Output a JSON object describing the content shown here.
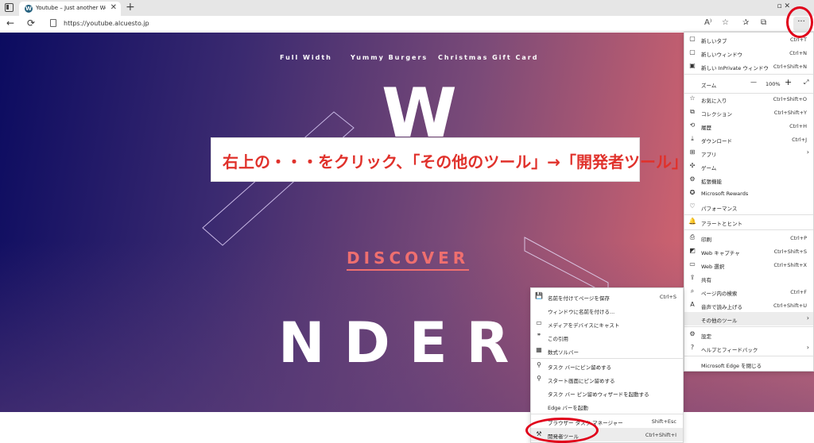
{
  "tab": {
    "title": "Youtube – Just another WordPre",
    "close": "✕",
    "new": "+"
  },
  "window": {
    "controls": "▫  ✕"
  },
  "address": {
    "back": "←",
    "reload": "⟳",
    "url": "https://youtube.alcuesto.jp",
    "more": "···"
  },
  "toolbar_icons": [
    "read-aloud-icon",
    "favorite-icon",
    "collections-star-icon",
    "collections-icon"
  ],
  "page": {
    "nav": [
      "Full Width",
      "Yummy Burgers",
      "Christmas Gift Card"
    ],
    "w": "W",
    "discover": "DISCOVER",
    "nder": "NDER"
  },
  "annotation": {
    "text": "右上の・・・をクリック、「その他のツール」→「開発者ツール」"
  },
  "main_menu": {
    "items": [
      {
        "icon": "▢",
        "label": "新しいタブ",
        "shortcut": "Ctrl+T"
      },
      {
        "icon": "▢",
        "label": "新しいウィンドウ",
        "shortcut": "Ctrl+N"
      },
      {
        "icon": "▣",
        "label": "新しい InPrivate ウィンドウ",
        "shortcut": "Ctrl+Shift+N"
      },
      {
        "icon": "",
        "label": "ズーム",
        "shortcut": ""
      },
      {
        "icon": "☆",
        "label": "お気に入り",
        "shortcut": "Ctrl+Shift+O"
      },
      {
        "icon": "⧉",
        "label": "コレクション",
        "shortcut": "Ctrl+Shift+Y"
      },
      {
        "icon": "⟲",
        "label": "履歴",
        "shortcut": "Ctrl+H"
      },
      {
        "icon": "⤓",
        "label": "ダウンロード",
        "shortcut": "Ctrl+J"
      },
      {
        "icon": "⊞",
        "label": "アプリ",
        "shortcut": ""
      },
      {
        "icon": "✣",
        "label": "ゲーム",
        "shortcut": ""
      },
      {
        "icon": "⚙",
        "label": "拡張機能",
        "shortcut": ""
      },
      {
        "icon": "✪",
        "label": "Microsoft Rewards",
        "shortcut": ""
      },
      {
        "icon": "♡",
        "label": "パフォーマンス",
        "shortcut": ""
      },
      {
        "icon": "🔔",
        "label": "アラートとヒント",
        "shortcut": ""
      },
      {
        "icon": "⎙",
        "label": "印刷",
        "shortcut": "Ctrl+P"
      },
      {
        "icon": "◩",
        "label": "Web キャプチャ",
        "shortcut": "Ctrl+Shift+S"
      },
      {
        "icon": "▭",
        "label": "Web 選択",
        "shortcut": "Ctrl+Shift+X"
      },
      {
        "icon": "⇪",
        "label": "共有",
        "shortcut": ""
      },
      {
        "icon": "⌕",
        "label": "ページ内の検索",
        "shortcut": "Ctrl+F"
      },
      {
        "icon": "A",
        "label": "音声で読み上げる",
        "shortcut": "Ctrl+Shift+U"
      },
      {
        "icon": "",
        "label": "その他のツール",
        "shortcut": ""
      },
      {
        "icon": "⚙",
        "label": "設定",
        "shortcut": ""
      },
      {
        "icon": "?",
        "label": "ヘルプとフィードバック",
        "shortcut": ""
      },
      {
        "icon": "",
        "label": "Microsoft Edge を閉じる",
        "shortcut": ""
      }
    ],
    "zoom": {
      "minus": "—",
      "value": "100%",
      "plus": "+",
      "full": "⤢"
    }
  },
  "sub_menu": {
    "items": [
      {
        "icon": "💾",
        "label": "名前を付けてページを保存",
        "shortcut": "Ctrl+S"
      },
      {
        "icon": "",
        "label": "ウィンドウに名前を付ける...",
        "shortcut": ""
      },
      {
        "icon": "▭",
        "label": "メディアをデバイスにキャスト",
        "shortcut": ""
      },
      {
        "icon": "❞",
        "label": "この引用",
        "shortcut": ""
      },
      {
        "icon": "▦",
        "label": "数式ソルバー",
        "shortcut": ""
      },
      {
        "icon": "⚲",
        "label": "タスク バーにピン留めする",
        "shortcut": ""
      },
      {
        "icon": "⚲",
        "label": "スタート画面にピン留めする",
        "shortcut": ""
      },
      {
        "icon": "",
        "label": "タスク バー ピン留めウィザードを起動する",
        "shortcut": ""
      },
      {
        "icon": "",
        "label": "Edge バーを起動",
        "shortcut": ""
      },
      {
        "icon": "",
        "label": "ブラウザー タスク マネージャー",
        "shortcut": "Shift+Esc"
      },
      {
        "icon": "⚒",
        "label": "開発者ツール",
        "shortcut": "Ctrl+Shift+I"
      }
    ]
  },
  "colors": {
    "annotation_red": "#e0001a",
    "discover": "#ef6f6f"
  }
}
